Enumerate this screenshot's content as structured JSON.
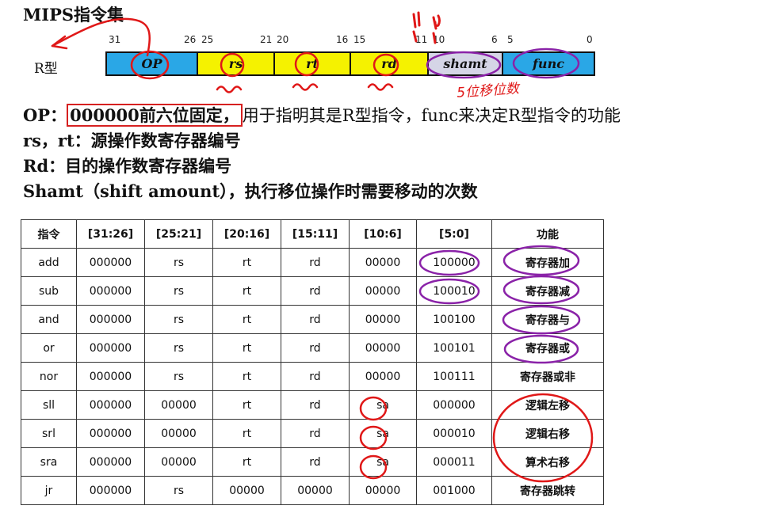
{
  "title": "MIPS指令集",
  "format": {
    "label": "R型",
    "bit_numbers": [
      "31",
      "26",
      "25",
      "21",
      "20",
      "16",
      "15",
      "11",
      "10",
      "6",
      "5",
      "0"
    ],
    "fields": [
      {
        "name": "OP",
        "color": "#2aa7e6"
      },
      {
        "name": "rs",
        "color": "#f5f200"
      },
      {
        "name": "rt",
        "color": "#f5f200"
      },
      {
        "name": "rd",
        "color": "#f5f200"
      },
      {
        "name": "shamt",
        "color": "#d5d5e6"
      },
      {
        "name": "func",
        "color": "#2aa7e6"
      }
    ],
    "handwritten_note": "5位移位数"
  },
  "descriptions": {
    "op_prefix": "OP：",
    "op_boxed": "000000前六位固定，",
    "op_rest": "用于指明其是R型指令，func来决定R型指令的功能",
    "line2": "rs，rt：源操作数寄存器编号",
    "line3": "Rd：目的操作数寄存器编号",
    "line4": "Shamt（shift amount），执行移位操作时需要移动的次数"
  },
  "table": {
    "headers": [
      "指令",
      "[31:26]",
      "[25:21]",
      "[20:16]",
      "[15:11]",
      "[10:6]",
      "[5:0]",
      "功能"
    ],
    "rows": [
      [
        "add",
        "000000",
        "rs",
        "rt",
        "rd",
        "00000",
        "100000",
        "寄存器加"
      ],
      [
        "sub",
        "000000",
        "rs",
        "rt",
        "rd",
        "00000",
        "100010",
        "寄存器减"
      ],
      [
        "and",
        "000000",
        "rs",
        "rt",
        "rd",
        "00000",
        "100100",
        "寄存器与"
      ],
      [
        "or",
        "000000",
        "rs",
        "rt",
        "rd",
        "00000",
        "100101",
        "寄存器或"
      ],
      [
        "nor",
        "000000",
        "rs",
        "rt",
        "rd",
        "00000",
        "100111",
        "寄存器或非"
      ],
      [
        "sll",
        "000000",
        "00000",
        "rt",
        "rd",
        "sa",
        "000000",
        "逻辑左移"
      ],
      [
        "srl",
        "000000",
        "00000",
        "rt",
        "rd",
        "sa",
        "000010",
        "逻辑右移"
      ],
      [
        "sra",
        "000000",
        "00000",
        "rt",
        "rd",
        "sa",
        "000011",
        "算术右移"
      ],
      [
        "jr",
        "000000",
        "rs",
        "00000",
        "00000",
        "00000",
        "001000",
        "寄存器跳转"
      ]
    ]
  },
  "annotation_colors": {
    "red": "#e01818",
    "purple": "#8a22a8"
  }
}
